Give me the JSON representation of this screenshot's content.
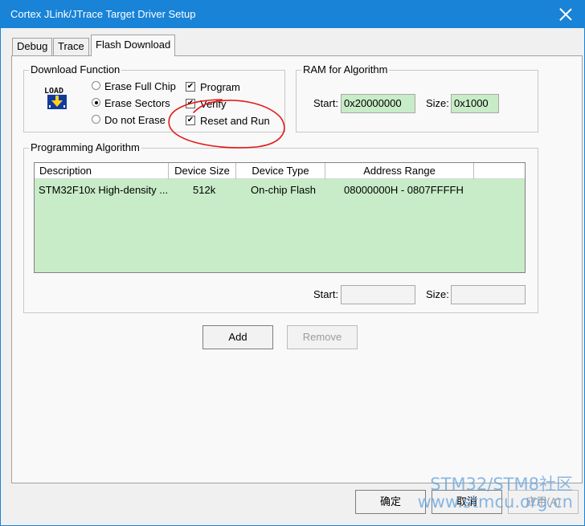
{
  "window": {
    "title": "Cortex JLink/JTrace Target Driver Setup"
  },
  "tabs": [
    {
      "label": "Debug",
      "active": false
    },
    {
      "label": "Trace",
      "active": false
    },
    {
      "label": "Flash Download",
      "active": true
    }
  ],
  "download_function": {
    "group_label": "Download Function",
    "icon": "load-icon",
    "erase_options": [
      {
        "label": "Erase Full Chip",
        "selected": false
      },
      {
        "label": "Erase Sectors",
        "selected": true
      },
      {
        "label": "Do not Erase",
        "selected": false
      }
    ],
    "checkboxes": [
      {
        "label": "Program",
        "checked": true
      },
      {
        "label": "Verify",
        "checked": true
      },
      {
        "label": "Reset and Run",
        "checked": true
      }
    ]
  },
  "ram_for_algorithm": {
    "group_label": "RAM for Algorithm",
    "start_label": "Start:",
    "start_value": "0x20000000",
    "size_label": "Size:",
    "size_value": "0x1000"
  },
  "programming_algorithm": {
    "group_label": "Programming Algorithm",
    "columns": [
      "Description",
      "Device Size",
      "Device Type",
      "Address Range"
    ],
    "rows": [
      [
        "STM32F10x High-density ...",
        "512k",
        "On-chip Flash",
        "08000000H - 0807FFFFH"
      ]
    ],
    "start_label": "Start:",
    "start_value": "",
    "size_label": "Size:",
    "size_value": ""
  },
  "buttons": {
    "add": "Add",
    "remove": "Remove",
    "ok": "确定",
    "cancel": "取消",
    "apply": "应用(A)"
  },
  "watermark": {
    "line1": "STM32/STM8社区",
    "line2": "www.stmcu.org.cn"
  },
  "colors": {
    "title_bar": "#1883d7",
    "field_green": "#c8ecc8",
    "annotation_red": "#e31b1b"
  }
}
